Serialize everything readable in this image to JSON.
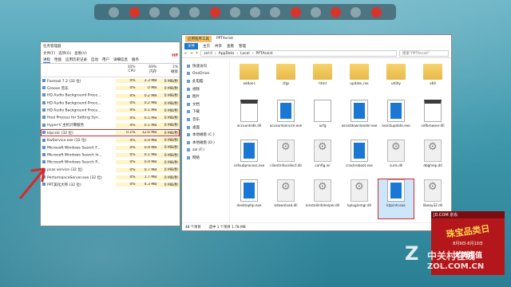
{
  "dock": {
    "apps": [
      "app-1",
      "app-2",
      "app-3",
      "app-4",
      "app-5",
      "app-6",
      "app-7",
      "app-8",
      "app-9",
      "app-10",
      "app-11",
      "app-12",
      "app-13",
      "app-14"
    ]
  },
  "task_manager": {
    "title": "任务管理器",
    "menu": [
      "文件(F)",
      "选项(O)",
      "查看(V)"
    ],
    "tabs": [
      "进程",
      "性能",
      "应用历史记录",
      "启动",
      "用户",
      "详细信息",
      "服务"
    ],
    "headers": {
      "name": "",
      "cpu": "CPU",
      "mem": "内存",
      "disk": "磁盘",
      "cpu_pct": "10%",
      "mem_pct": "69%",
      "disk_pct": "1%"
    },
    "rows": [
      {
        "name": "Foxmail 7.2 (32 位)",
        "cpu": "0%",
        "mem": "2.3 MB",
        "disk": "0 MB/秒"
      },
      {
        "name": "Groove 音乐",
        "cpu": "0%",
        "mem": "0 MB",
        "disk": "0 MB/秒"
      },
      {
        "name": "HD Audio Background Proce...",
        "cpu": "0%",
        "mem": "0.2 MB",
        "disk": "0 MB/秒"
      },
      {
        "name": "HD Audio Background Proce...",
        "cpu": "0%",
        "mem": "0.2 MB",
        "disk": "0 MB/秒"
      },
      {
        "name": "HD Audio Background Proce...",
        "cpu": "0%",
        "mem": "0.1 MB",
        "disk": "0 MB/秒"
      },
      {
        "name": "Host Process for Setting Syn...",
        "cpu": "0%",
        "mem": "0.5 MB",
        "disk": "0 MB/秒"
      },
      {
        "name": "Hyper-V 主机计算服务",
        "cpu": "0%",
        "mem": "0.1 MB",
        "disk": "0 MB/秒"
      },
      {
        "name": "ktpcntr (32 位)",
        "cpu": "0.1%",
        "mem": "12.6 MB",
        "disk": "0 MB/秒"
      },
      {
        "name": "KwService.exe (32 位)",
        "cpu": "0%",
        "mem": "0.9 MB",
        "disk": "0 MB/秒"
      },
      {
        "name": "Microsoft Windows Search F...",
        "cpu": "0%",
        "mem": "0.9 MB",
        "disk": "0 MB/秒"
      },
      {
        "name": "Microsoft Windows Search In...",
        "cpu": "0%",
        "mem": "0.1 MB",
        "disk": "0 MB/秒"
      },
      {
        "name": "Microsoft Windows Search P...",
        "cpu": "0%",
        "mem": "0.9 MB",
        "disk": "0 MB/秒"
      },
      {
        "name": "pcas service (32 位)",
        "cpu": "0%",
        "mem": "0.7 MB",
        "disk": "0 MB/秒"
      },
      {
        "name": "PerformanceServer.exe (32 位)",
        "cpu": "0%",
        "mem": "1.7 MB",
        "disk": "0 MB/秒"
      },
      {
        "name": "PPT美化大师 (32 位)",
        "cpu": "0%",
        "mem": "4.3 MB",
        "disk": "0 MB/秒"
      }
    ],
    "selected_index": 7,
    "hp_badge": "HP"
  },
  "explorer": {
    "title": "PPTAssist",
    "ribbon_tag": "应用程序工具",
    "tabs": [
      "文件",
      "主页",
      "共享",
      "查看",
      "管理"
    ],
    "path": [
      "zol-li",
      "AppData",
      "Local",
      "PPTAssist"
    ],
    "search_placeholder": "搜索\"PPTAssist\"",
    "nav": [
      "快速访问",
      "OneDrive",
      "此电脑",
      "视频",
      "图片",
      "文档",
      "下载",
      "音乐",
      "桌面",
      "本地磁盘 (C:)",
      "本地磁盘 (D:)",
      "zol (F:)",
      "网络"
    ],
    "items": [
      {
        "name": "addons",
        "type": "folder"
      },
      {
        "name": "cfgs",
        "type": "folder"
      },
      {
        "name": "html",
        "type": "folder"
      },
      {
        "name": "update_res",
        "type": "folder"
      },
      {
        "name": "utility",
        "type": "folder"
      },
      {
        "name": "x64",
        "type": "folder"
      },
      {
        "name": "accountsdk.dll",
        "type": "file"
      },
      {
        "name": "accountservice.exe",
        "type": "exe"
      },
      {
        "name": "acfg",
        "type": "doc"
      },
      {
        "name": "assistdownloader.exe",
        "type": "exe"
      },
      {
        "name": "assistupdate.exe",
        "type": "exe"
      },
      {
        "name": "cefbrowser.dll",
        "type": "file"
      },
      {
        "name": "cefsubprocess.exe",
        "type": "exe"
      },
      {
        "name": "clientinfocollect.dll",
        "type": "dll"
      },
      {
        "name": "config.ini",
        "type": "dll"
      },
      {
        "name": "crashreboot.exe",
        "type": "exe"
      },
      {
        "name": "curls.dll",
        "type": "dll"
      },
      {
        "name": "dbghelp.dll",
        "type": "dll"
      },
      {
        "name": "desktoptip.exe",
        "type": "exe"
      },
      {
        "name": "kdownload.dll",
        "type": "dll"
      },
      {
        "name": "kinstallinfohelper.dll",
        "type": "dll"
      },
      {
        "name": "kpluginmgr.dll",
        "type": "dll"
      },
      {
        "name": "ktpcntr.exe",
        "type": "exe"
      },
      {
        "name": "libeay32.dll",
        "type": "dll"
      }
    ],
    "selected_item": "ktpcntr.exe",
    "status_count": "48 个项目",
    "status_selected": "选中 1 个项目  1.78 MB"
  },
  "ad": {
    "brand": "JD.COM 京东",
    "headline": "珠宝品类日",
    "sub": "8月9日-8月10日",
    "tagline": "大牌超值"
  },
  "watermark": {
    "brand": "中关村在线",
    "domain": "ZOL.COM.CN"
  }
}
